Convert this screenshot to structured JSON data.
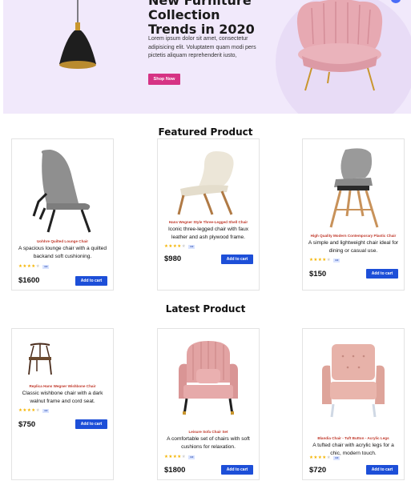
{
  "hero": {
    "title_line1": "New Furniture",
    "title_line2": "Collection",
    "title_line3": "Trends in 2020",
    "text": "Lorem ipsum dolor sit amet, consectetur adipisicing elit. Voluptatem quam modi pers pictetis aliquam reprehenderit iusto,",
    "shop_label": "Shop Now"
  },
  "featured": {
    "title": "Featured Product",
    "products": [
      {
        "name": "Uohhre Quilted Lounge Chair",
        "desc": "A spacious lounge chair with a quilted backand soft cushioning.",
        "rating_badge": "4.0",
        "price": "$1600",
        "button": "Add to cart"
      },
      {
        "name": "Hans Wegner Style Three-Legged Shell Chair",
        "desc": "Iconic three-legged chair with faux leather and ash plywood frame.",
        "rating_badge": "4.0",
        "price": "$980",
        "button": "Add to cart"
      },
      {
        "name": "High Quality Modern Contemporary Plastic Chair",
        "desc": "A simple and lightweight chair ideal for dining or casual use.",
        "rating_badge": "4.0",
        "price": "$150",
        "button": "Add to cart"
      }
    ]
  },
  "latest": {
    "title": "Latest Product",
    "products": [
      {
        "name": "Replica Hans Wegner Wishbone Chair",
        "desc": "Classic wishbone chair with a dark walnut frame and cord seat.",
        "rating_badge": "4.0",
        "price": "$750",
        "button": "Add to cart"
      },
      {
        "name": "Leisure Sofa Chair Set",
        "desc": "A comfortable set of chairs with soft cushions for relaxation.",
        "rating_badge": "4.0",
        "price": "$1800",
        "button": "Add to cart"
      },
      {
        "name": "Blandia Chair - Tuft Button - Acrylic Legs",
        "desc": "A tufted chair with acrylic legs for a chic, modern touch.",
        "rating_badge": "4.0",
        "price": "$720",
        "button": "Add to cart"
      }
    ]
  },
  "colors": {
    "hero_bg": "#f1e9fb",
    "shop_button": "#d63384",
    "cart_button": "#1d4fd8",
    "product_name": "#c0392b",
    "star": "#f5b400"
  }
}
